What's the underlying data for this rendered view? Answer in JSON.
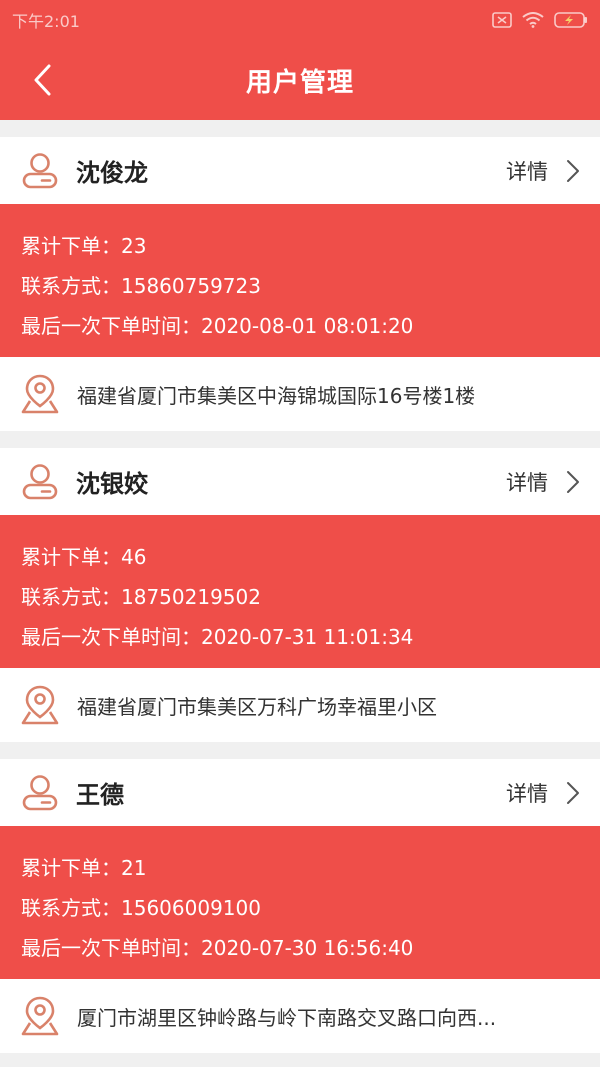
{
  "status_bar": {
    "time": "下午2:01",
    "icons": [
      "sim-off-icon",
      "wifi-icon",
      "battery-charging-icon"
    ]
  },
  "nav": {
    "title": "用户管理",
    "back_icon": "chevron-left-icon"
  },
  "colors": {
    "accent": "#ef4e49",
    "background": "#f0f0f0",
    "card": "#ffffff",
    "icon": "#d9826a"
  },
  "users": [
    {
      "name": "沈俊龙",
      "detail_label": "详情",
      "orders": "累计下单：23",
      "contact": "联系方式：15860759723",
      "last_order": "最后一次下单时间：2020-08-01 08:01:20",
      "address": "福建省厦门市集美区中海锦城国际16号楼1楼"
    },
    {
      "name": "沈银姣",
      "detail_label": "详情",
      "orders": "累计下单：46",
      "contact": "联系方式：18750219502",
      "last_order": "最后一次下单时间：2020-07-31 11:01:34",
      "address": "福建省厦门市集美区万科广场幸福里小区"
    },
    {
      "name": "王德",
      "detail_label": "详情",
      "orders": "累计下单：21",
      "contact": "联系方式：15606009100",
      "last_order": "最后一次下单时间：2020-07-30 16:56:40",
      "address": "厦门市湖里区钟岭路与岭下南路交叉路口向西..."
    }
  ]
}
